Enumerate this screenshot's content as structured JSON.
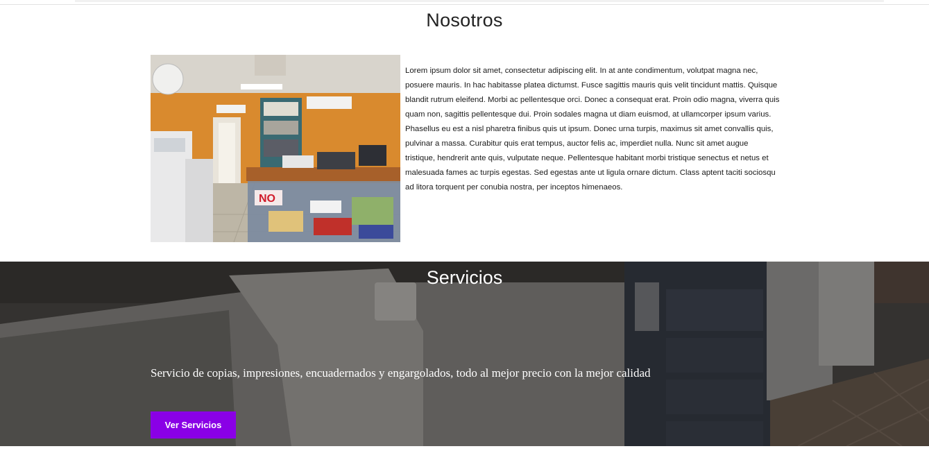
{
  "about": {
    "title": "Nosotros",
    "paragraph": "Lorem ipsum dolor sit amet, consectetur adipiscing elit. In at ante condimentum, volutpat magna nec, posuere mauris. In hac habitasse platea dictumst. Fusce sagittis mauris quis velit tincidunt mattis. Quisque blandit rutrum eleifend. Morbi ac pellentesque orci. Donec a consequat erat. Proin odio magna, viverra quis quam non, sagittis pellentesque dui. Proin sodales magna ut diam euismod, at ullamcorper ipsum varius. Phasellus eu est a nisl pharetra finibus quis ut ipsum. Donec urna turpis, maximus sit amet convallis quis, pulvinar a massa. Curabitur quis erat tempus, auctor felis ac, imperdiet nulla. Nunc sit amet augue tristique, hendrerit ante quis, vulputate neque. Pellentesque habitant morbi tristique senectus et netus et malesuada fames ac turpis egestas. Sed egestas ante ut ligula ornare dictum. Class aptent taciti sociosqu ad litora torquent per conubia nostra, per inceptos himenaeos."
  },
  "services": {
    "title": "Servicios",
    "description": "Servicio de copias, impresiones, encuadernados y engargolados, todo al mejor precio con la mejor calidad",
    "button_label": "Ver Servicios"
  },
  "colors": {
    "accent": "#8a00e6",
    "services_overlay": "#2a2a2a",
    "shop_wall": "#d98a2e"
  }
}
